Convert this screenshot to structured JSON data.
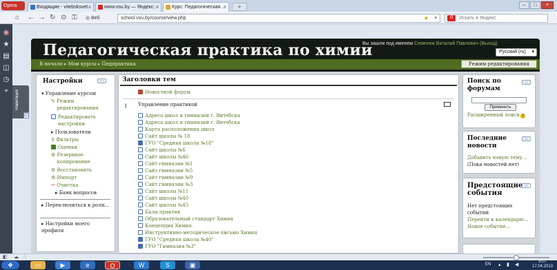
{
  "browser": {
    "brand": "Opera",
    "tabs": [
      {
        "label": "Входящие - vitebsksvet..."
      },
      {
        "label": "www.vsu.by — Яндекс:..."
      },
      {
        "label": "Курс: Педагогическая ..."
      }
    ],
    "url_prefix": "Веб",
    "url": "school.vsu.by/course/view.php",
    "search_placeholder": "Искать в Яндекс"
  },
  "header": {
    "title": "Педагогическая практика по химии",
    "login_prefix": "Вы зашли под именем",
    "user_name": "Семенюк Виталий Павлович",
    "logout": "(Выход)",
    "language": "Русский (ru)"
  },
  "breadcrumb": [
    "В начало",
    "Мои курсы",
    "Педпрактика"
  ],
  "edit_mode_button": "Режим редактирования",
  "settings_block": {
    "title": "Настройки",
    "course_admin": "Управление курсом",
    "items": [
      {
        "label": "Режим редактирования"
      },
      {
        "label": "Редактировать настройки"
      },
      {
        "label": "Пользователи"
      },
      {
        "label": "Фильтры"
      },
      {
        "label": "Оценки"
      },
      {
        "label": "Резервное копирование"
      },
      {
        "label": "Восстановить"
      },
      {
        "label": "Импорт"
      },
      {
        "label": "Очистка"
      },
      {
        "label": "Банк вопросов"
      }
    ],
    "switch_role": "Переключиться к роли...",
    "my_profile_settings": "Настройки моего профиля"
  },
  "side_tab_label": "Навигация",
  "main": {
    "title": "Заголовки тем",
    "news_forum": "Новостной форум",
    "section_number": "1",
    "section_title": "Управление практикой",
    "resources": [
      {
        "label": "Адреса школ и гимназий г. Витебска",
        "type": "doc"
      },
      {
        "label": "Адреса школ и гимназий г. Витебска",
        "type": "doc"
      },
      {
        "label": "Карта расположения школ",
        "type": "doc"
      },
      {
        "label": "Сайт школы № 18",
        "type": "doc"
      },
      {
        "label": "ГУО \"Средняя школа №18\"",
        "type": "url"
      },
      {
        "label": "Сайт школы №6",
        "type": "doc"
      },
      {
        "label": "Сайт школы №46",
        "type": "doc"
      },
      {
        "label": "Сайт гимназии №1",
        "type": "doc"
      },
      {
        "label": "Сайт гимназии №5",
        "type": "doc"
      },
      {
        "label": "Сайт гимназии №9",
        "type": "doc"
      },
      {
        "label": "Сайт гимназии №3",
        "type": "doc"
      },
      {
        "label": "Сайт школы №11",
        "type": "doc"
      },
      {
        "label": "Сайт школы №40",
        "type": "doc"
      },
      {
        "label": "Сайт школы №45",
        "type": "doc"
      },
      {
        "label": "Базы практик",
        "type": "doc"
      },
      {
        "label": "Образовательный стандарт Химия",
        "type": "doc"
      },
      {
        "label": "Концепция Химия",
        "type": "doc"
      },
      {
        "label": "Инструктивно-методическое письмо Химия",
        "type": "doc"
      },
      {
        "label": "ГУО \"Средняя школа №40\"",
        "type": "url"
      },
      {
        "label": "ГУО \"Гимназия №3\"",
        "type": "url"
      }
    ]
  },
  "search_block": {
    "title": "Поиск по форумам",
    "button": "Применить",
    "advanced": "Расширенный поиск"
  },
  "news_block": {
    "title": "Последние новости",
    "add_topic": "Добавить новую тему...",
    "no_news": "(Пока новостей нет)"
  },
  "events_block": {
    "title": "Предстоящие события",
    "none": "Нет предстоящих событий",
    "go_calendar": "Перейти к календарю...",
    "new_event": "Новое событие..."
  },
  "taskbar": {
    "lang": "EN",
    "time": "9:07",
    "date": "17.04.2013"
  },
  "colors": {
    "header_bg": "#131a14",
    "nav_bg": "#4f6d20",
    "link": "#5b7a2c"
  }
}
